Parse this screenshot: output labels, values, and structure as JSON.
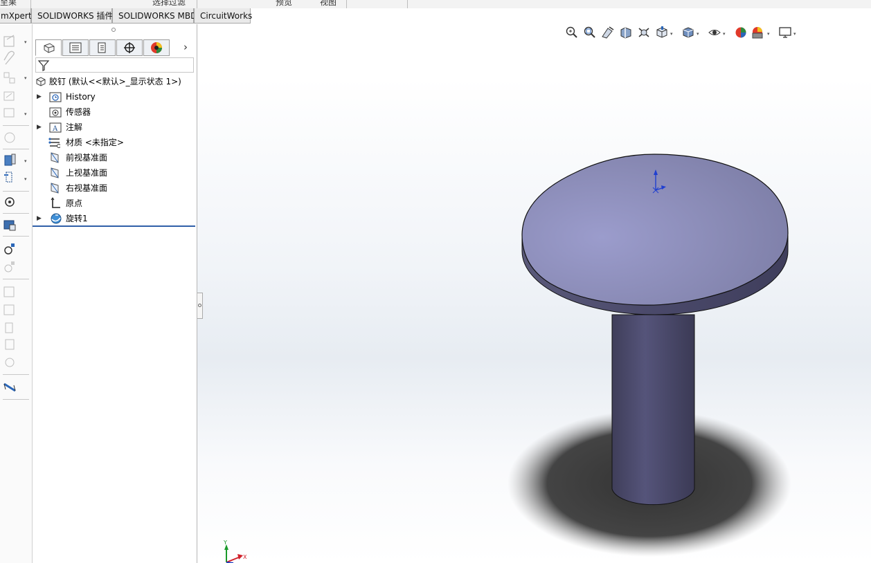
{
  "top_strip": {
    "fragments": [
      "至果",
      "选择过滤",
      "预览",
      "视图"
    ]
  },
  "tabs": [
    "mXpert",
    "SOLIDWORKS 插件",
    "SOLIDWORKS MBD",
    "CircuitWorks"
  ],
  "feature_manager": {
    "tabs": [
      "featuremanager-tree",
      "propertymanager",
      "configurationmanager",
      "dimxpertmanager",
      "displaymanager"
    ],
    "more_label": "›",
    "root": "胶钉  (默认<<默认>_显示状态 1>)",
    "items": [
      {
        "label": "History",
        "icon": "history-folder-icon",
        "expandable": true
      },
      {
        "label": "传感器",
        "icon": "sensor-icon",
        "expandable": false
      },
      {
        "label": "注解",
        "icon": "annotation-icon",
        "expandable": true
      },
      {
        "label": "材质 <未指定>",
        "icon": "material-icon",
        "expandable": false
      },
      {
        "label": "前视基准面",
        "icon": "plane-icon",
        "expandable": false
      },
      {
        "label": "上视基准面",
        "icon": "plane-icon",
        "expandable": false
      },
      {
        "label": "右视基准面",
        "icon": "plane-icon",
        "expandable": false
      },
      {
        "label": "原点",
        "icon": "origin-icon",
        "expandable": false
      },
      {
        "label": "旋转1",
        "icon": "revolve-feature-icon",
        "expandable": true
      }
    ]
  },
  "triad": {
    "y_label": "Y",
    "x_label": "X"
  },
  "colors": {
    "accent": "#2f5fa8",
    "model_top": "#8e8fbd",
    "model_side": "#4c4b6e",
    "shadow": "#3a3a3a"
  }
}
